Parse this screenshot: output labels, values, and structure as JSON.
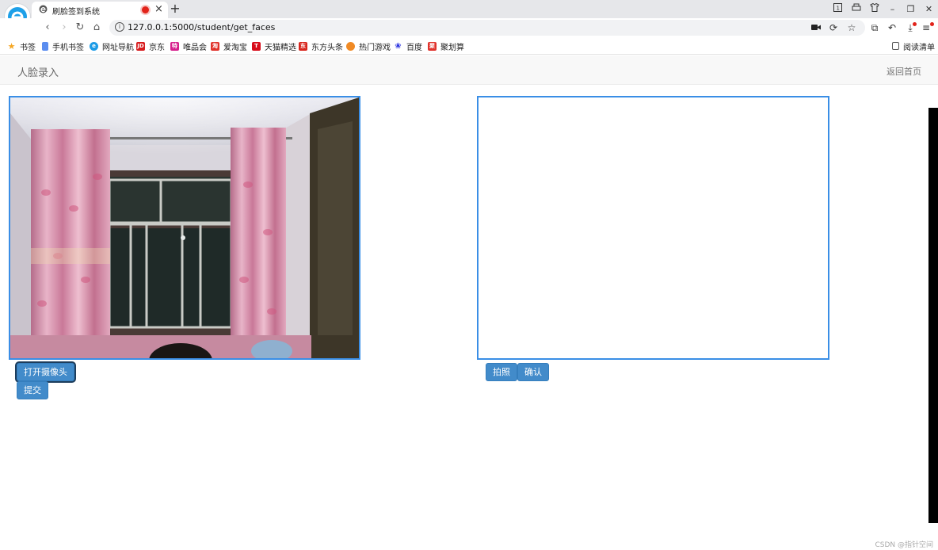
{
  "browser": {
    "tab_title": "刷脸签到系统",
    "url": "127.0.0.1:5000/student/get_faces",
    "bookmarks": [
      {
        "label": "书签",
        "icon": "star-icon",
        "color": "#f5a623"
      },
      {
        "label": "手机书签",
        "icon": "phone-icon",
        "color": "#5b8def"
      },
      {
        "label": "网址导航",
        "icon": "browser-e-icon",
        "color": "#1c9be6"
      },
      {
        "label": "京东",
        "icon": "jd-icon",
        "color": "#d71c1e"
      },
      {
        "label": "唯品会",
        "icon": "vip-icon",
        "color": "#d6208d"
      },
      {
        "label": "爱淘宝",
        "icon": "taobao-icon",
        "color": "#e0322b"
      },
      {
        "label": "天猫精选",
        "icon": "tmall-icon",
        "color": "#d70c19"
      },
      {
        "label": "东方头条",
        "icon": "toutiao-icon",
        "color": "#d8261d"
      },
      {
        "label": "热门游戏",
        "icon": "game-icon",
        "color": "#f08a24"
      },
      {
        "label": "百度",
        "icon": "baidu-paw-icon",
        "color": "#2a32e0"
      },
      {
        "label": "聚划算",
        "icon": "juhuasuan-icon",
        "color": "#e0322b"
      }
    ],
    "reading_list_label": "阅读清单"
  },
  "page": {
    "title": "人脸录入",
    "home_link": "返回首页"
  },
  "left_panel": {
    "open_camera_button": "打开摄像头",
    "submit_button": "提交"
  },
  "right_panel": {
    "capture_button": "拍照",
    "confirm_button": "确认"
  },
  "watermark": "CSDN @指针空间",
  "colors": {
    "button": "#428bca",
    "frame_border": "#3a8ee6"
  }
}
